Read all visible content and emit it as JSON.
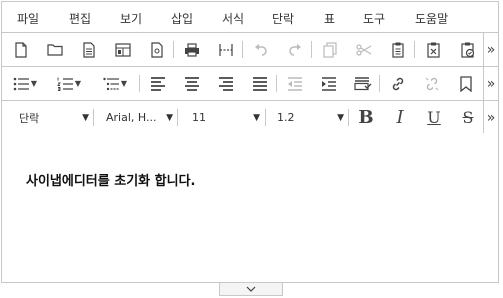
{
  "menubar": {
    "items": [
      "파일",
      "편집",
      "보기",
      "삽입",
      "서식",
      "단락",
      "표",
      "도구",
      "도움말"
    ]
  },
  "toolbar1": {
    "icons": [
      "new-document-icon",
      "open-folder-icon",
      "document-template-icon",
      "page-layout-icon",
      "preview-icon",
      "print-icon",
      "page-margin-icon",
      "undo-icon",
      "redo-icon",
      "copy-icon",
      "cut-icon",
      "paste-icon",
      "paste-text-icon",
      "paste-image-icon"
    ],
    "more": "»"
  },
  "toolbar2": {
    "icons": [
      "bullet-list-icon",
      "numbered-list-icon",
      "multilevel-list-icon",
      "align-left-icon",
      "align-center-icon",
      "align-right-icon",
      "align-justify-icon",
      "outdent-icon",
      "indent-icon",
      "paragraph-format-icon",
      "link-icon",
      "unlink-icon",
      "bookmark-icon"
    ],
    "more": "»"
  },
  "toolbar3": {
    "paragraph_style": "단락",
    "font_family": "Arial, H...",
    "font_size": "11",
    "line_height": "1.2",
    "bold": "B",
    "italic": "I",
    "underline": "U",
    "strike": "S",
    "more": "»"
  },
  "content": {
    "text": "사이냅에디터를 초기화 합니다."
  },
  "resize": {
    "icon": "chevron-down-icon"
  }
}
